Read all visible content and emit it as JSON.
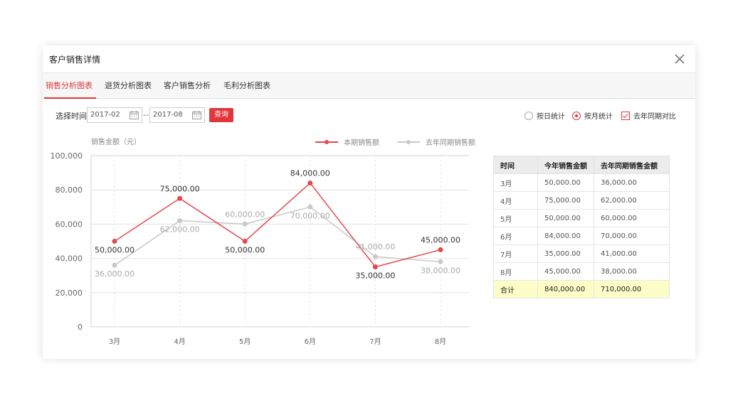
{
  "modal": {
    "title": "客户销售详情"
  },
  "tabs": [
    {
      "label": "销售分析图表",
      "active": true
    },
    {
      "label": "退货分析图表",
      "active": false
    },
    {
      "label": "客户销售分析",
      "active": false
    },
    {
      "label": "毛利分析图表",
      "active": false
    }
  ],
  "toolbar": {
    "time_label": "选择时间:",
    "start_date": "2017-02",
    "separator": "--",
    "end_date": "2017-08",
    "query_label": "查询",
    "options": [
      {
        "label": "按日统计",
        "type": "radio",
        "checked": false
      },
      {
        "label": "按月统计",
        "type": "radio",
        "checked": true
      },
      {
        "label": "去年同期对比",
        "type": "checkbox",
        "checked": true
      }
    ]
  },
  "chart_data": {
    "type": "line",
    "ylabel": "销售金额（元）",
    "categories": [
      "3月",
      "4月",
      "5月",
      "6月",
      "7月",
      "8月"
    ],
    "ylim": [
      0,
      100000
    ],
    "yticks": [
      "0",
      "20,000",
      "40,000",
      "60,000",
      "80,000",
      "100,000"
    ],
    "grid": true,
    "legend_position": "top-right",
    "series": [
      {
        "name": "本期销售额",
        "color": "#e8474c",
        "values": [
          50000,
          75000,
          50000,
          84000,
          35000,
          45000
        ],
        "labels": [
          "50,000.00",
          "75,000.00",
          "50,000.00",
          "84,000.00",
          "35,000.00",
          "45,000.00"
        ]
      },
      {
        "name": "去年同期销售额",
        "color": "#c8c8c8",
        "values": [
          36000,
          62000,
          60000,
          70000,
          41000,
          38000
        ],
        "labels": [
          "36,000.00",
          "62,000.00",
          "60,000.00",
          "70,000.00",
          "41,000.00",
          "38,000.00"
        ]
      }
    ]
  },
  "table": {
    "headers": [
      "时间",
      "今年销售金额",
      "去年同期销售金额"
    ],
    "rows": [
      [
        "3月",
        "50,000.00",
        "36,000.00"
      ],
      [
        "4月",
        "75,000.00",
        "62,000.00"
      ],
      [
        "5月",
        "50,000.00",
        "60,000.00"
      ],
      [
        "6月",
        "84,000.00",
        "70,000.00"
      ],
      [
        "7月",
        "35,000.00",
        "41,000.00"
      ],
      [
        "8月",
        "45,000.00",
        "38,000.00"
      ]
    ],
    "total": [
      "合计",
      "840,000.00",
      "710,000.00"
    ]
  }
}
